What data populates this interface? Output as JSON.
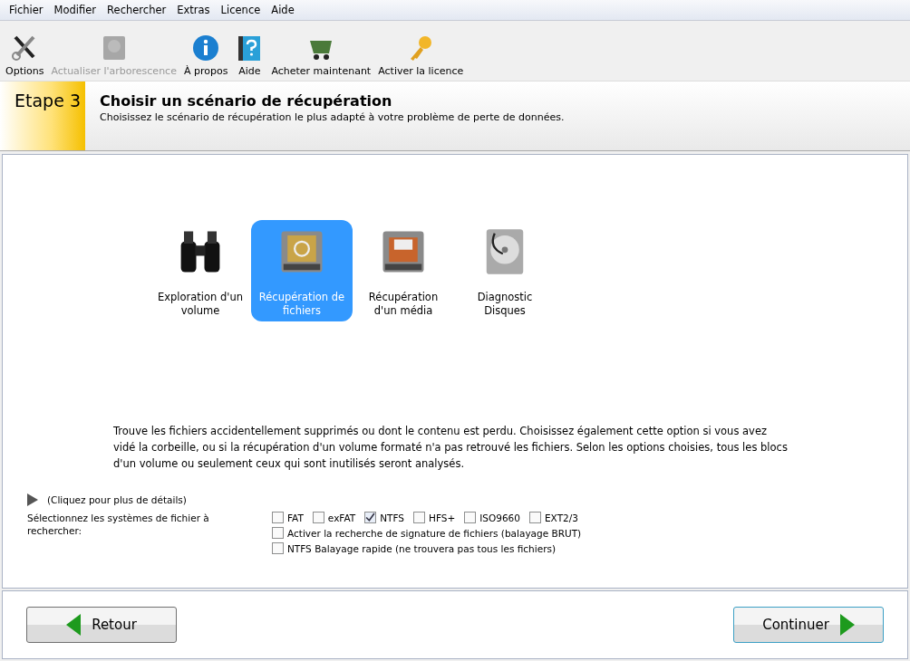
{
  "menu": [
    "Fichier",
    "Modifier",
    "Rechercher",
    "Extras",
    "Licence",
    "Aide"
  ],
  "toolbar": [
    {
      "label": "Options",
      "kind": "tools",
      "disabled": false
    },
    {
      "label": "Actualiser l'arborescence",
      "kind": "drive",
      "disabled": true
    },
    {
      "label": "À propos",
      "kind": "info",
      "disabled": false
    },
    {
      "label": "Aide",
      "kind": "help",
      "disabled": false
    },
    {
      "label": "Acheter maintenant",
      "kind": "cart",
      "disabled": false
    },
    {
      "label": "Activer la licence",
      "kind": "key",
      "disabled": false
    }
  ],
  "step": {
    "badge": "Etape 3",
    "title": "Choisir un scénario de récupération",
    "subtitle": "Choisissez le scénario de récupération le plus adapté à votre problème de perte de données."
  },
  "scenarios": [
    {
      "label": "Exploration d'un volume",
      "kind": "binoculars",
      "selected": false
    },
    {
      "label": "Récupération de fichiers",
      "kind": "recycle",
      "selected": true
    },
    {
      "label": "Récupération d'un média",
      "kind": "media",
      "selected": false
    },
    {
      "label": "Diagnostic Disques",
      "kind": "disk",
      "selected": false
    }
  ],
  "description": "Trouve les fichiers accidentellement supprimés ou dont le contenu est perdu. Choisissez également cette option si vous avez vidé la corbeille, ou si la récupération d'un volume formaté n'a pas retrouvé les fichiers. Selon les options choisies, tous les blocs d'un volume ou seulement ceux qui sont inutilisés seront analysés.",
  "details_link": "(Cliquez pour plus de détails)",
  "fs_label": "Sélectionnez les systèmes de fichier à rechercher:",
  "filesystems": [
    {
      "label": "FAT",
      "checked": false
    },
    {
      "label": "exFAT",
      "checked": false
    },
    {
      "label": "NTFS",
      "checked": true
    },
    {
      "label": "HFS+",
      "checked": false
    },
    {
      "label": "ISO9660",
      "checked": false
    },
    {
      "label": "EXT2/3",
      "checked": false
    }
  ],
  "options": [
    {
      "label": "Activer la recherche de signature de fichiers (balayage BRUT)",
      "checked": false
    },
    {
      "label": "NTFS Balayage rapide (ne trouvera pas tous les fichiers)",
      "checked": false
    }
  ],
  "buttons": {
    "back": "Retour",
    "next": "Continuer"
  }
}
